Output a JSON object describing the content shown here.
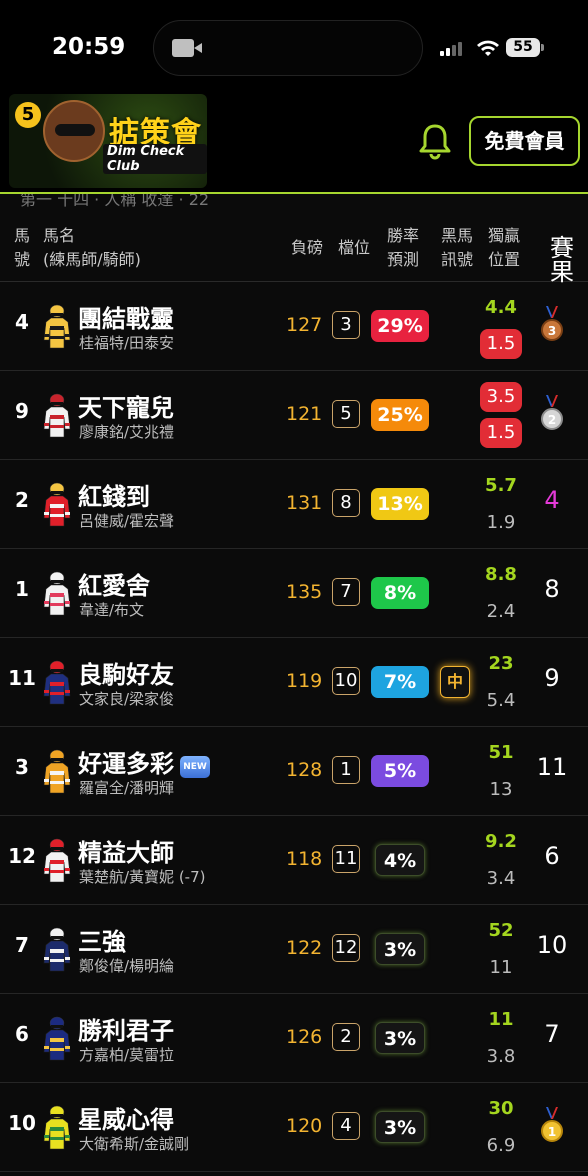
{
  "status_bar": {
    "time": "20:59",
    "battery": "55"
  },
  "header": {
    "logo_badge": "5",
    "logo_title": "掂策會",
    "logo_subtitle": "Dim Check Club",
    "member_button": "免費會員"
  },
  "cutoff_text": "第一 十四 · 人稱 收達 · 22",
  "columns": {
    "no": "馬號",
    "name": "馬名",
    "name_sub": "(練馬師/騎師)",
    "weight": "負磅",
    "gate": "檔位",
    "pred": "勝率預測",
    "dark": "黑馬訊號",
    "odds": "獨贏位置",
    "result": "賽果"
  },
  "rows": [
    {
      "no": "4",
      "name": "團結戰靈",
      "sub": "桂福特/田泰安",
      "weight": "127",
      "gate": "3",
      "pct": "29%",
      "pct_color": "#e8223f",
      "dark": "",
      "win": "4.4",
      "win_red": false,
      "place": "1.5",
      "place_red": true,
      "result": "",
      "result_pink": false,
      "medal": "bronze",
      "silk_primary": "#f4c542",
      "silk_secondary": "#1a1a1a",
      "silk_cap": "#f4c542",
      "new": false
    },
    {
      "no": "9",
      "name": "天下寵兒",
      "sub": "廖康銘/艾兆禮",
      "weight": "121",
      "gate": "5",
      "pct": "25%",
      "pct_color": "#f58a0a",
      "dark": "",
      "win": "3.5",
      "win_red": true,
      "place": "1.5",
      "place_red": true,
      "result": "",
      "result_pink": false,
      "medal": "silver",
      "silk_primary": "#f2f2f2",
      "silk_secondary": "#c8232c",
      "silk_cap": "#c8232c",
      "new": false
    },
    {
      "no": "2",
      "name": "紅錢到",
      "sub": "呂健威/霍宏聲",
      "weight": "131",
      "gate": "8",
      "pct": "13%",
      "pct_color": "#f0c814",
      "dark": "",
      "win": "5.7",
      "win_red": false,
      "place": "1.9",
      "place_red": false,
      "result": "4",
      "result_pink": true,
      "medal": "",
      "silk_primary": "#e0202a",
      "silk_secondary": "#f5f5f5",
      "silk_cap": "#f4c542",
      "new": false
    },
    {
      "no": "1",
      "name": "紅愛舍",
      "sub": "韋達/布文",
      "weight": "135",
      "gate": "7",
      "pct": "8%",
      "pct_color": "#1ec74a",
      "dark": "",
      "win": "8.8",
      "win_red": false,
      "place": "2.4",
      "place_red": false,
      "result": "8",
      "result_pink": false,
      "medal": "",
      "silk_primary": "#f2f2f2",
      "silk_secondary": "#e23b5c",
      "silk_cap": "#f2f2f2",
      "new": false
    },
    {
      "no": "11",
      "name": "良駒好友",
      "sub": "文家良/梁家俊",
      "weight": "119",
      "gate": "10",
      "pct": "7%",
      "pct_color": "#1ea4e0",
      "dark": "中",
      "win": "23",
      "win_red": false,
      "place": "5.4",
      "place_red": false,
      "result": "9",
      "result_pink": false,
      "medal": "",
      "silk_primary": "#1f2f80",
      "silk_secondary": "#e0202a",
      "silk_cap": "#e0202a",
      "new": false
    },
    {
      "no": "3",
      "name": "好運多彩",
      "sub": "羅富全/潘明輝",
      "weight": "128",
      "gate": "1",
      "pct": "5%",
      "pct_color": "#7b4be0",
      "dark": "",
      "win": "51",
      "win_red": false,
      "place": "13",
      "place_red": false,
      "result": "11",
      "result_pink": false,
      "medal": "",
      "silk_primary": "#f0a424",
      "silk_secondary": "#f5f5f5",
      "silk_cap": "#f0a424",
      "new": true,
      "new_label": "NEW"
    },
    {
      "no": "12",
      "name": "精益大師",
      "sub": "葉楚航/黃寶妮 (-7)",
      "weight": "118",
      "gate": "11",
      "pct": "4%",
      "pct_color": "",
      "dark": "",
      "win": "9.2",
      "win_red": false,
      "place": "3.4",
      "place_red": false,
      "result": "6",
      "result_pink": false,
      "medal": "",
      "silk_primary": "#f2f2f2",
      "silk_secondary": "#e0202a",
      "silk_cap": "#e0202a",
      "new": false
    },
    {
      "no": "7",
      "name": "三強",
      "sub": "鄭俊偉/楊明綸",
      "weight": "122",
      "gate": "12",
      "pct": "3%",
      "pct_color": "",
      "dark": "",
      "win": "52",
      "win_red": false,
      "place": "11",
      "place_red": false,
      "result": "10",
      "result_pink": false,
      "medal": "",
      "silk_primary": "#1c2b6b",
      "silk_secondary": "#f2f2f2",
      "silk_cap": "#f2f2f2",
      "new": false
    },
    {
      "no": "6",
      "name": "勝利君子",
      "sub": "方嘉柏/莫雷拉",
      "weight": "126",
      "gate": "2",
      "pct": "3%",
      "pct_color": "",
      "dark": "",
      "win": "11",
      "win_red": false,
      "place": "3.8",
      "place_red": false,
      "result": "7",
      "result_pink": false,
      "medal": "",
      "silk_primary": "#1c2b80",
      "silk_secondary": "#f4c542",
      "silk_cap": "#1c2b80",
      "new": false
    },
    {
      "no": "10",
      "name": "星威心得",
      "sub": "大衛希斯/金誠剛",
      "weight": "120",
      "gate": "4",
      "pct": "3%",
      "pct_color": "",
      "dark": "",
      "win": "30",
      "win_red": false,
      "place": "6.9",
      "place_red": false,
      "result": "",
      "result_pink": false,
      "medal": "gold",
      "silk_primary": "#e8e020",
      "silk_secondary": "#2c8a3c",
      "silk_cap": "#e8e020",
      "new": false
    }
  ]
}
